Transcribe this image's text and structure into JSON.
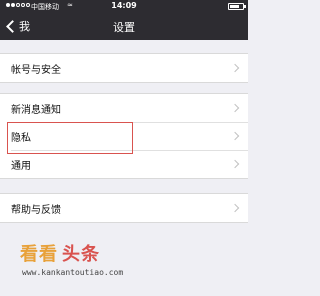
{
  "status_bar": {
    "signal_dots_filled": 2,
    "signal_dots_total": 5,
    "carrier": "中国移动",
    "time": "14:09",
    "wifi_icon": "wifi-icon",
    "battery_icon": "battery-icon"
  },
  "nav": {
    "back_label": "我",
    "title": "设置"
  },
  "groups": [
    {
      "items": [
        {
          "label": "帐号与安全"
        }
      ]
    },
    {
      "items": [
        {
          "label": "新消息通知"
        },
        {
          "label": "隐私"
        },
        {
          "label": "通用"
        }
      ]
    },
    {
      "items": [
        {
          "label": "帮助与反馈"
        }
      ]
    }
  ],
  "highlight": {
    "target": "隐私",
    "color": "#d9534f"
  },
  "watermark": {
    "kan": "看看",
    "tou": "头条",
    "url": "www.kankantoutiao.com"
  },
  "colors": {
    "nav_bg": "#2d2c31",
    "page_bg": "#efeff4",
    "row_bg": "#ffffff",
    "watermark_orange": "#e8a13a",
    "watermark_red": "#d9534f"
  }
}
